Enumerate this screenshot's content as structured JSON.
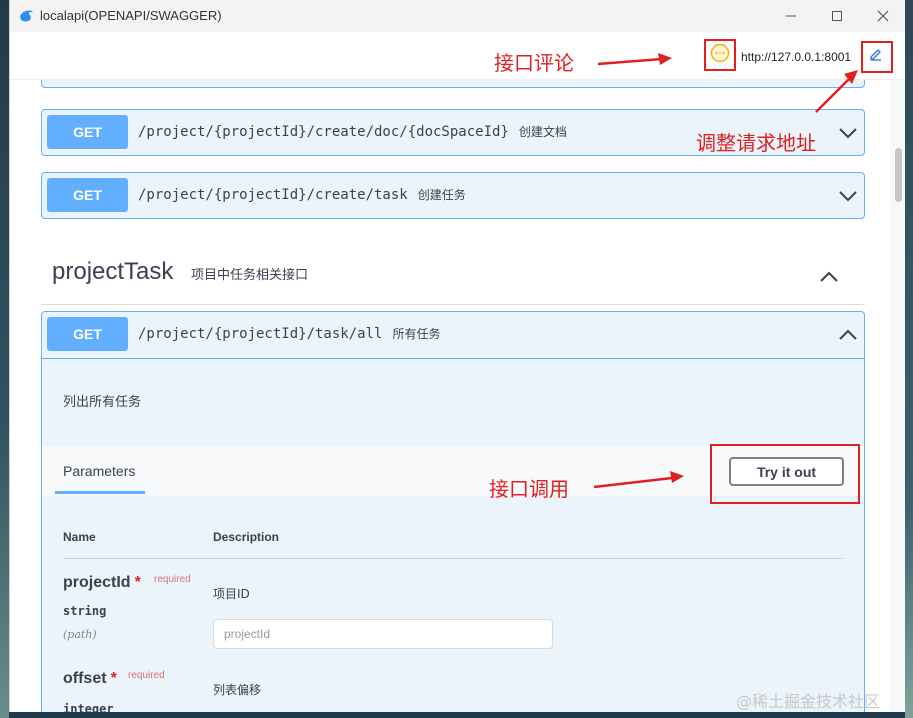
{
  "window": {
    "title": "localapi(OPENAPI/SWAGGER)"
  },
  "topbar": {
    "base_url": "http://127.0.0.1:8001"
  },
  "operations": [
    {
      "method": "GET",
      "path": "/project/{projectId}/create/doc/{docSpaceId}",
      "summary": "创建文档"
    },
    {
      "method": "GET",
      "path": "/project/{projectId}/create/task",
      "summary": "创建任务"
    }
  ],
  "tag": {
    "name": "projectTask",
    "description": "项目中任务相关接口"
  },
  "open_op": {
    "method": "GET",
    "path": "/project/{projectId}/task/all",
    "summary": "所有任务",
    "description": "列出所有任务",
    "parameters_tab": "Parameters",
    "try_button": "Try it out",
    "columns": {
      "name": "Name",
      "description": "Description"
    },
    "params": [
      {
        "name": "projectId",
        "required": "required",
        "type": "string",
        "in": "(path)",
        "description": "项目ID",
        "placeholder": "projectId"
      },
      {
        "name": "offset",
        "required": "required",
        "type": "integer",
        "description": "列表偏移"
      }
    ]
  },
  "annotations": {
    "comment": "接口评论",
    "url": "调整请求地址",
    "call": "接口调用"
  },
  "watermark": "@稀土掘金技术社区",
  "colors": {
    "get": "#61affe",
    "annotation": "#e02020"
  }
}
